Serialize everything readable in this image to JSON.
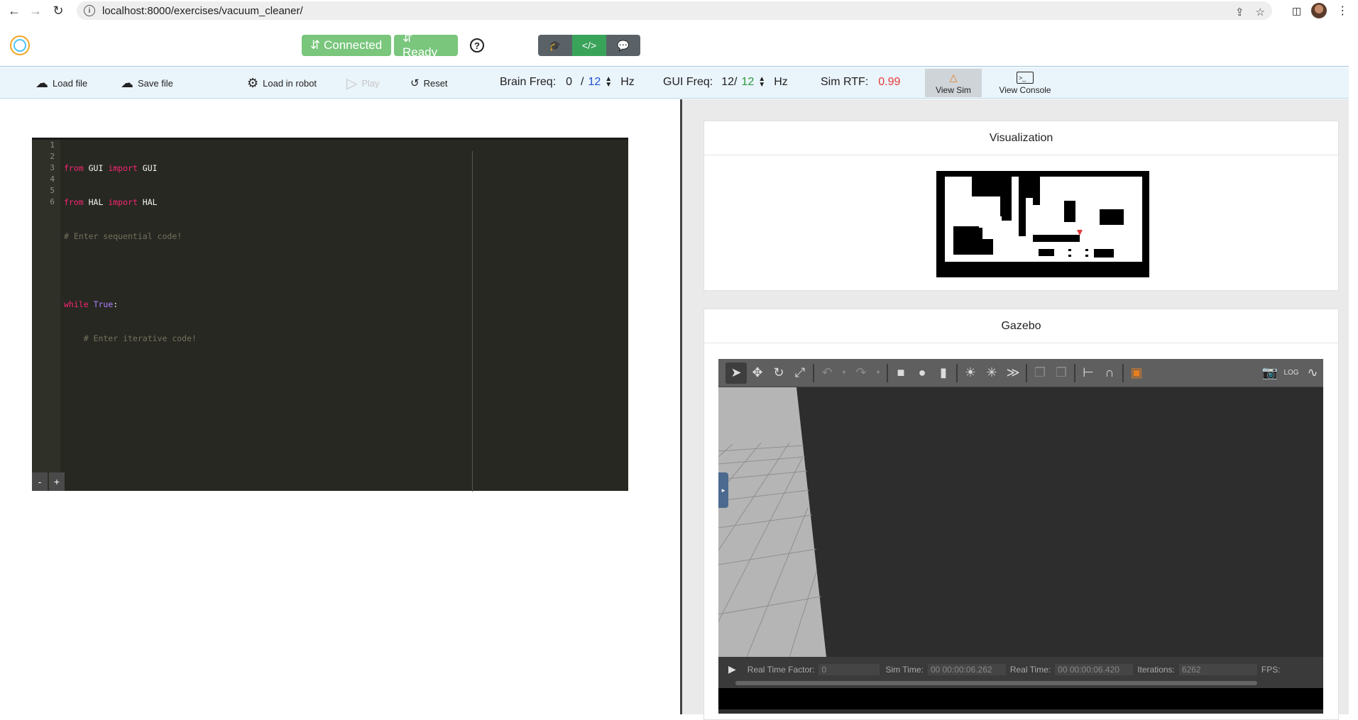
{
  "browser": {
    "url": "localhost:8000/exercises/vacuum_cleaner/",
    "back_icon": "arrow-left-icon",
    "forward_icon": "arrow-right-icon",
    "reload_icon": "reload-icon"
  },
  "header": {
    "connected_label": "⇵ Connected",
    "ready_label": "⇵ Ready",
    "help_label": "?"
  },
  "toolbar": {
    "load_file": "Load file",
    "save_file": "Save file",
    "load_robot": "Load in robot",
    "play": "Play",
    "reset": "Reset",
    "brain_freq_label": "Brain Freq:",
    "brain_freq_value": "0",
    "brain_freq_sep": "/",
    "brain_freq_target": "12",
    "brain_freq_unit": "Hz",
    "gui_freq_label": "GUI Freq:",
    "gui_freq_value": "12/",
    "gui_freq_target": "12",
    "gui_freq_unit": "Hz",
    "sim_rtf_label": "Sim RTF:",
    "sim_rtf_value": "0.99",
    "view_sim": "View Sim",
    "view_console": "View Console"
  },
  "editor": {
    "line_numbers": [
      "1",
      "2",
      "3",
      "4",
      "5",
      "6"
    ],
    "lines": [
      {
        "a": "from",
        "b": " GUI ",
        "c": "import",
        "d": " GUI"
      },
      {
        "a": "from",
        "b": " HAL ",
        "c": "import",
        "d": " HAL"
      },
      {
        "comment": "# Enter sequential code!"
      },
      {},
      {
        "a": "while",
        "b": " ",
        "c": "True",
        "d": ":"
      },
      {
        "comment": "    # Enter iterative code!"
      }
    ],
    "zoom_out": "-",
    "zoom_in": "+"
  },
  "visualization": {
    "title": "Visualization"
  },
  "gazebo": {
    "title": "Gazebo",
    "real_time_factor_label": "Real Time Factor:",
    "real_time_factor_value": "0",
    "sim_time_label": "Sim Time:",
    "sim_time_value": "00 00:00:06.262",
    "real_time_label": "Real Time:",
    "real_time_value": "00 00:00:06.420",
    "iterations_label": "Iterations:",
    "iterations_value": "6262",
    "fps_label": "FPS:"
  },
  "colors": {
    "connected": "#79c67c",
    "rtf": "#e53935",
    "brain_target": "#1f4fd6",
    "gui_target": "#2a9a3a"
  }
}
